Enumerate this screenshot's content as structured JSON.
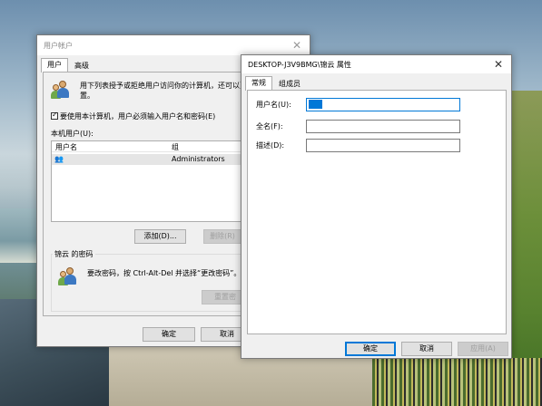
{
  "user_accounts": {
    "title": "用户帐户",
    "tabs": [
      "用户",
      "高级"
    ],
    "description_line1": "用下列表授予或拒绝用户访问你的计算机，还可以更改",
    "description_line2": "置。",
    "checkbox_label": "要使用本计算机，用户必须输入用户名和密码(E)",
    "users_label": "本机用户(U):",
    "columns": [
      "用户名",
      "组"
    ],
    "rows": [
      {
        "username": "",
        "group": "Administrators"
      }
    ],
    "add_button": "添加(D)...",
    "remove_button": "删除(R)",
    "password_group_title": "锦云 的密码",
    "password_text": "要改密码，按 Ctrl-Alt-Del 并选择“更改密码”。",
    "reset_password_button": "重置密",
    "ok_button": "确定",
    "cancel_button": "取消"
  },
  "properties": {
    "title": "DESKTOP-J3V9BMG\\锦云 属性",
    "tabs": [
      "常规",
      "组成员"
    ],
    "username_label": "用户名(U):",
    "fullname_label": "全名(F):",
    "description_label": "描述(D):",
    "username_value": "",
    "fullname_value": "",
    "description_value": "",
    "ok_button": "确定",
    "cancel_button": "取消",
    "apply_button": "应用(A)"
  },
  "colors": {
    "accent": "#0078d7",
    "window_bg": "#f0f0f0",
    "selected_row": "#e5e5e5"
  }
}
